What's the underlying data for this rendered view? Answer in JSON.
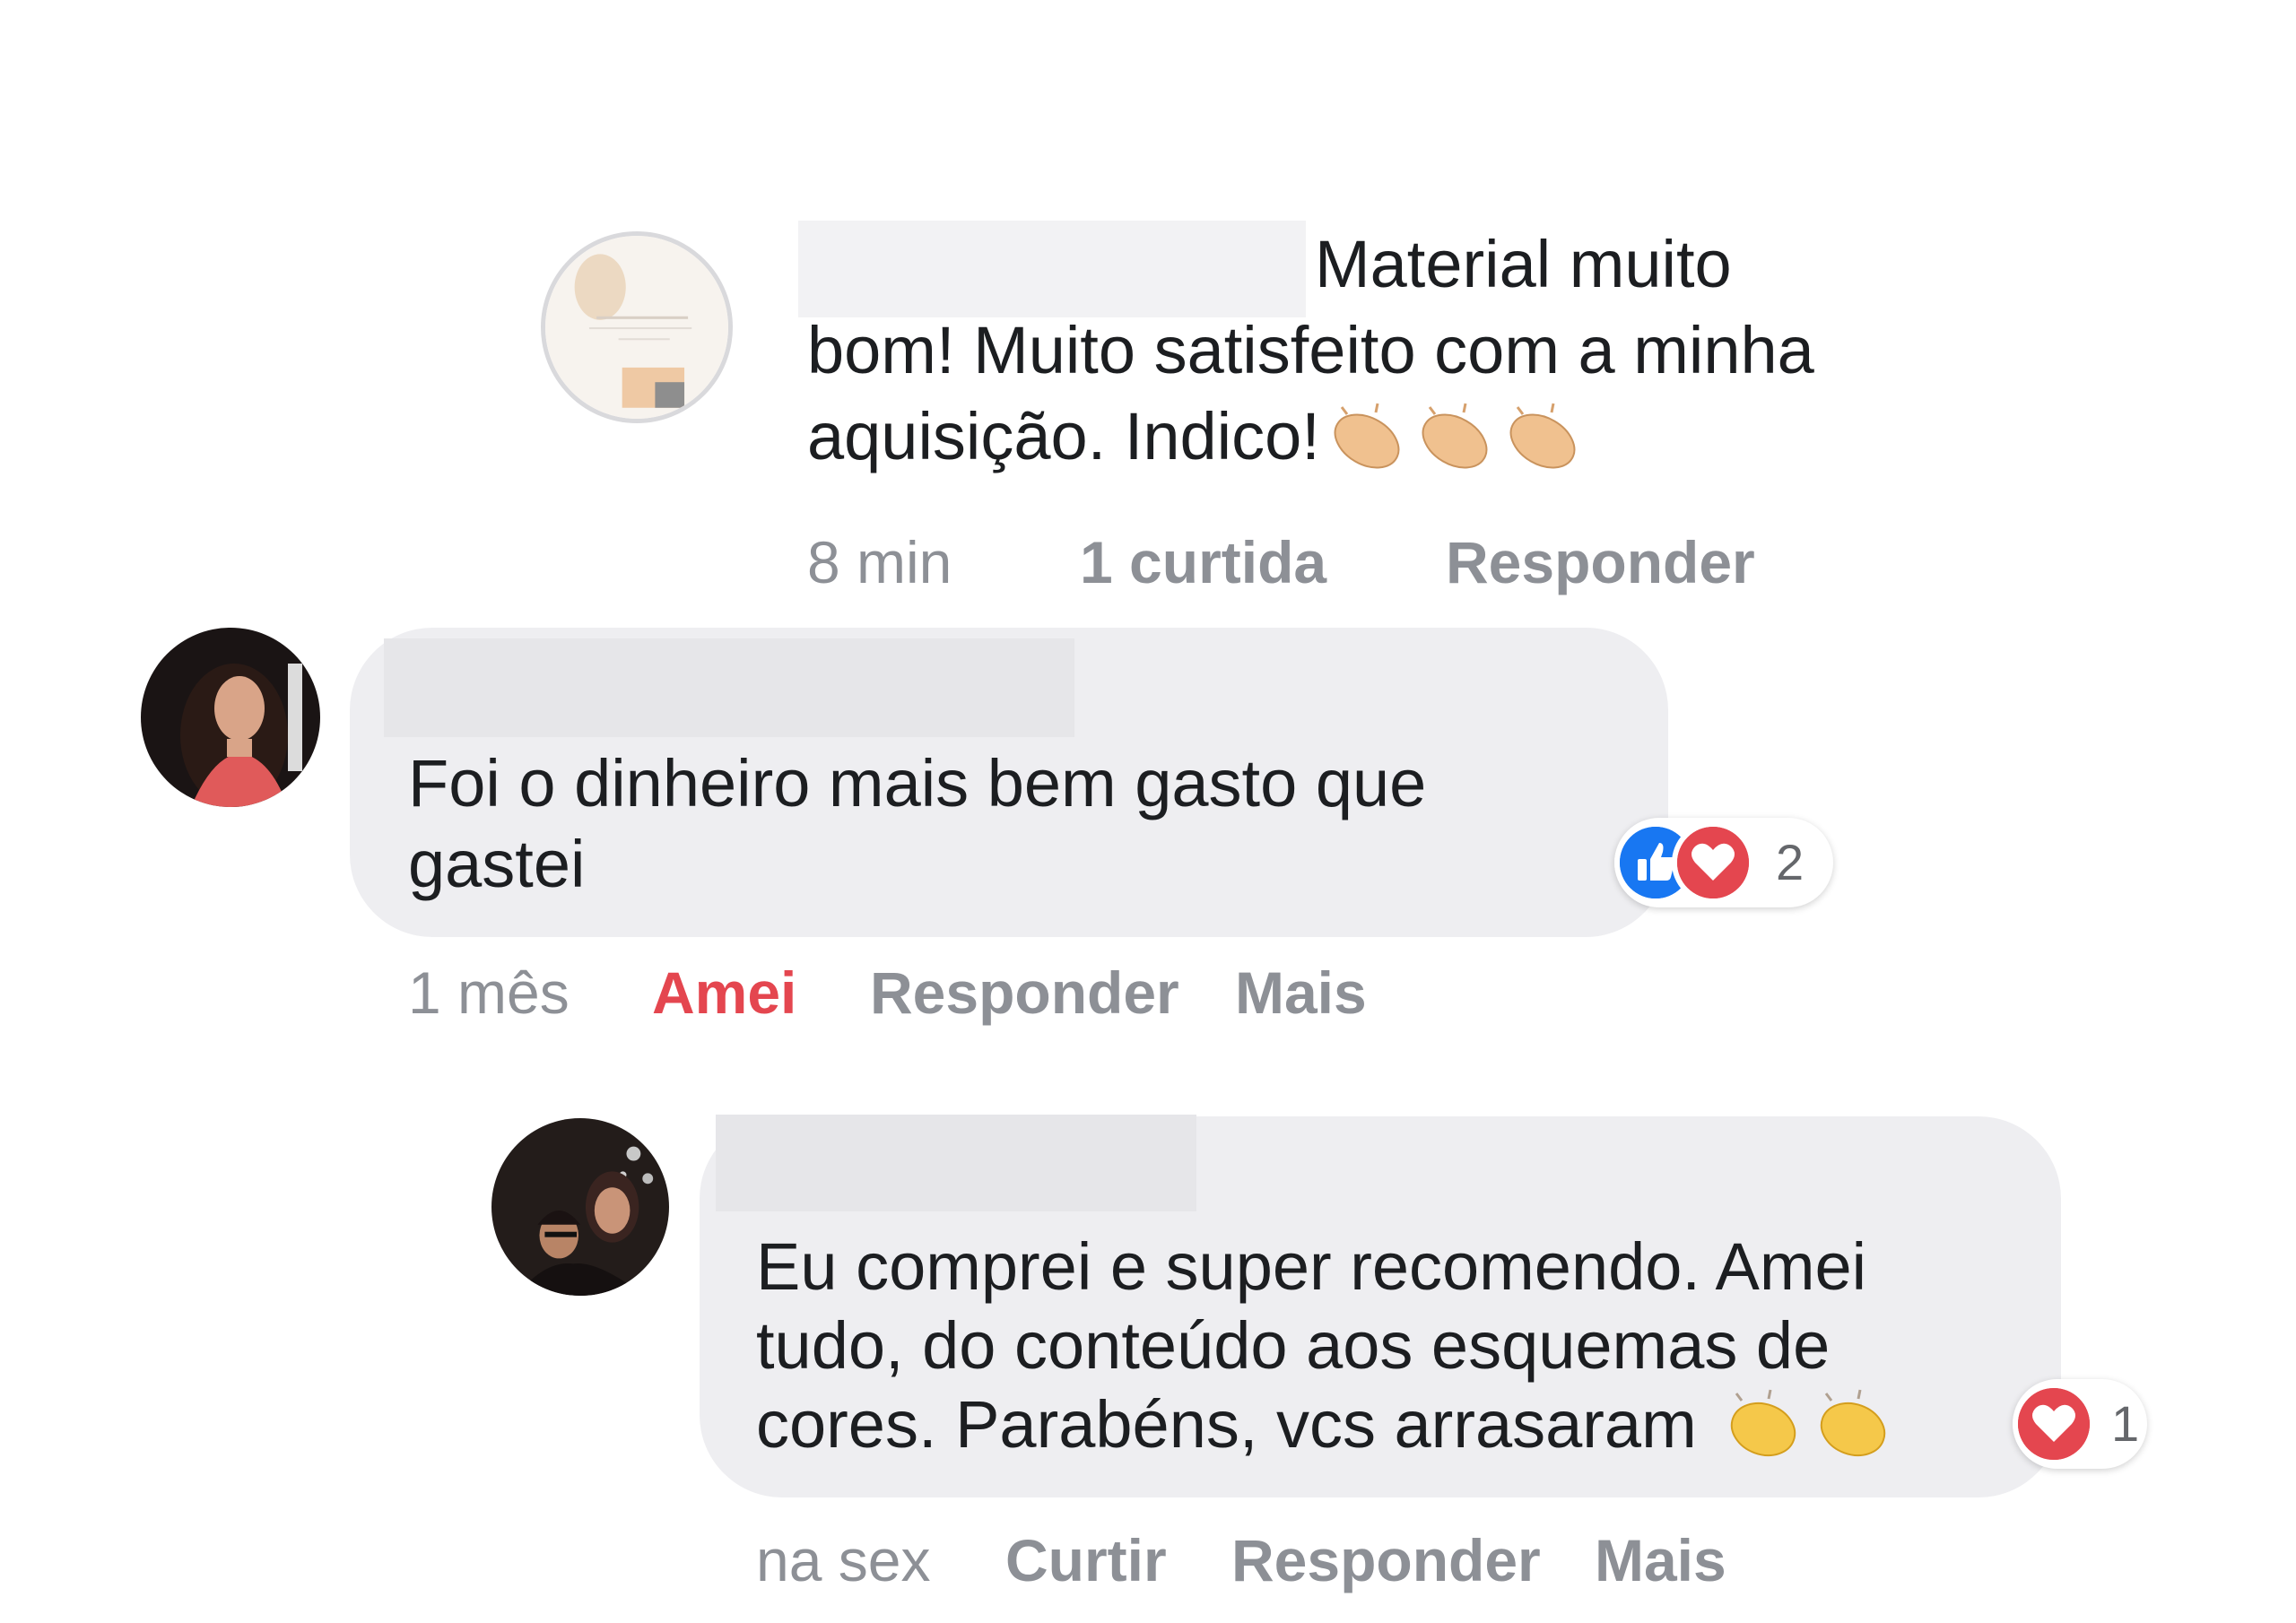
{
  "comments": [
    {
      "author_name": "",
      "text_lines": [
        "Material muito",
        "bom! Muito satisfeito com a minha",
        "aquisição. Indico!"
      ],
      "emoji": "clapping-hands-icon",
      "emoji_count": 3,
      "actions": {
        "time": "8 min",
        "likes": "1 curtida",
        "reply": "Responder"
      }
    },
    {
      "author_name": "",
      "text_lines": [
        "Foi o dinheiro mais bem gasto que",
        "gastei"
      ],
      "reactions": {
        "icons": [
          "like-icon",
          "love-icon"
        ],
        "count": "2"
      },
      "actions": {
        "time": "1 mês",
        "reaction": "Amei",
        "reply": "Responder",
        "more": "Mais"
      }
    },
    {
      "author_name": "",
      "text_lines": [
        "Eu comprei e super recomendo. Amei",
        "tudo, do conteúdo aos esquemas de",
        "cores. Parabéns, vcs arrasaram"
      ],
      "emoji": "clapping-hands-icon",
      "emoji_count": 2,
      "reactions": {
        "icons": [
          "love-icon"
        ],
        "count": "1"
      },
      "actions": {
        "time": "na sex",
        "like": "Curtir",
        "reply": "Responder",
        "more": "Mais"
      }
    }
  ],
  "colors": {
    "bubble": "#eeeef1",
    "meta_text": "#8d9096",
    "love_accent": "#e4464f",
    "like_blue": "#1877f2"
  }
}
